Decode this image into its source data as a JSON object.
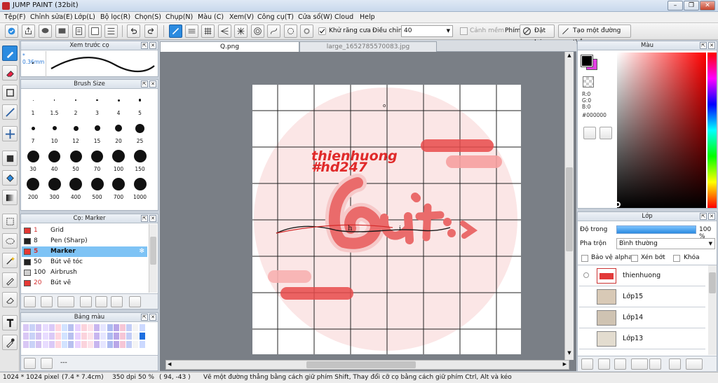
{
  "window": {
    "title": "JUMP PAINT (32bit)"
  },
  "menu": [
    "Tệp(F)",
    "Chỉnh sửa(E)",
    "Lớp(L)",
    "Bộ lọc(R)",
    "Chọn(S)",
    "Chụp(N)",
    "Màu (C)",
    "Xem(V)",
    "Công cụ(T)",
    "Cửa sổ(W)",
    "Cloud",
    "Help"
  ],
  "toolbar": {
    "antialias_label": "Khử răng cưa",
    "adjust_label": "Điều chỉnh",
    "adjust_value": "40",
    "warn_label": "Cảnh mềm",
    "key_label": "Phím",
    "reset_label": "Đặt lại",
    "straight_line_label": "Tạo một đường thẳng"
  },
  "brush_preview": {
    "title": "Xem trước cọ",
    "size": "0.36mm"
  },
  "brush_size": {
    "title": "Brush Size",
    "sizes": [
      "1",
      "1.5",
      "2",
      "3",
      "4",
      "5",
      "7",
      "10",
      "12",
      "15",
      "20",
      "25",
      "30",
      "40",
      "50",
      "70",
      "100",
      "150",
      "200",
      "300",
      "400",
      "500",
      "700",
      "1000"
    ]
  },
  "brush_list": {
    "title": "Cọ: Marker",
    "items": [
      {
        "size": "1",
        "name": "Grid",
        "color": "#e53935"
      },
      {
        "size": "8",
        "name": "Pen (Sharp)",
        "color": "#222222"
      },
      {
        "size": "5",
        "name": "Marker",
        "color": "#e53935",
        "selected": true
      },
      {
        "size": "50",
        "name": "Bút vẽ tóc",
        "color": "#222222"
      },
      {
        "size": "100",
        "name": "Airbrush",
        "color": "#cfcfcf"
      },
      {
        "size": "20",
        "name": "Bút vẽ",
        "color": "#e53935"
      }
    ]
  },
  "palette": {
    "title": "Bảng màu",
    "footer": "---"
  },
  "tabs": [
    {
      "label": "Q.png",
      "active": true
    },
    {
      "label": "large_1652785570083.jpg",
      "active": false
    }
  ],
  "artwork": {
    "line1": "thienhuong",
    "line2": "#hd247",
    "letter_small": "h",
    "letter_small2": "i",
    "marker": "o"
  },
  "color_panel": {
    "title": "Màu",
    "r": "R:0",
    "g": "G:0",
    "b": "B:0",
    "hex": "#000000",
    "fg": "#000000",
    "bg": "#e040e0"
  },
  "layers": {
    "title": "Lớp",
    "opacity_label": "Độ trong",
    "opacity_value": "100 %",
    "opacity_fraction": 1.0,
    "blend_label": "Pha trộn",
    "blend_value": "Bình thường",
    "protect_alpha": "Bảo vệ alpha",
    "clip": "Xén bớt",
    "lock": "Khóa",
    "items": [
      {
        "name": "thienhuong"
      },
      {
        "name": "Lớp15"
      },
      {
        "name": "Lớp14"
      },
      {
        "name": "Lớp13"
      }
    ]
  },
  "status": {
    "size": "1024 * 1024 pixel",
    "cm": "(7.4 * 7.4cm)",
    "dpi": "350 dpi",
    "zoom": "50 %",
    "coords": "( 94, -43 )",
    "hint": "Vẽ một đường thẳng bằng cách giữ phím Shift, Thay đổi cỡ cọ bằng cách giữ phím Ctrl, Alt và kéo"
  }
}
